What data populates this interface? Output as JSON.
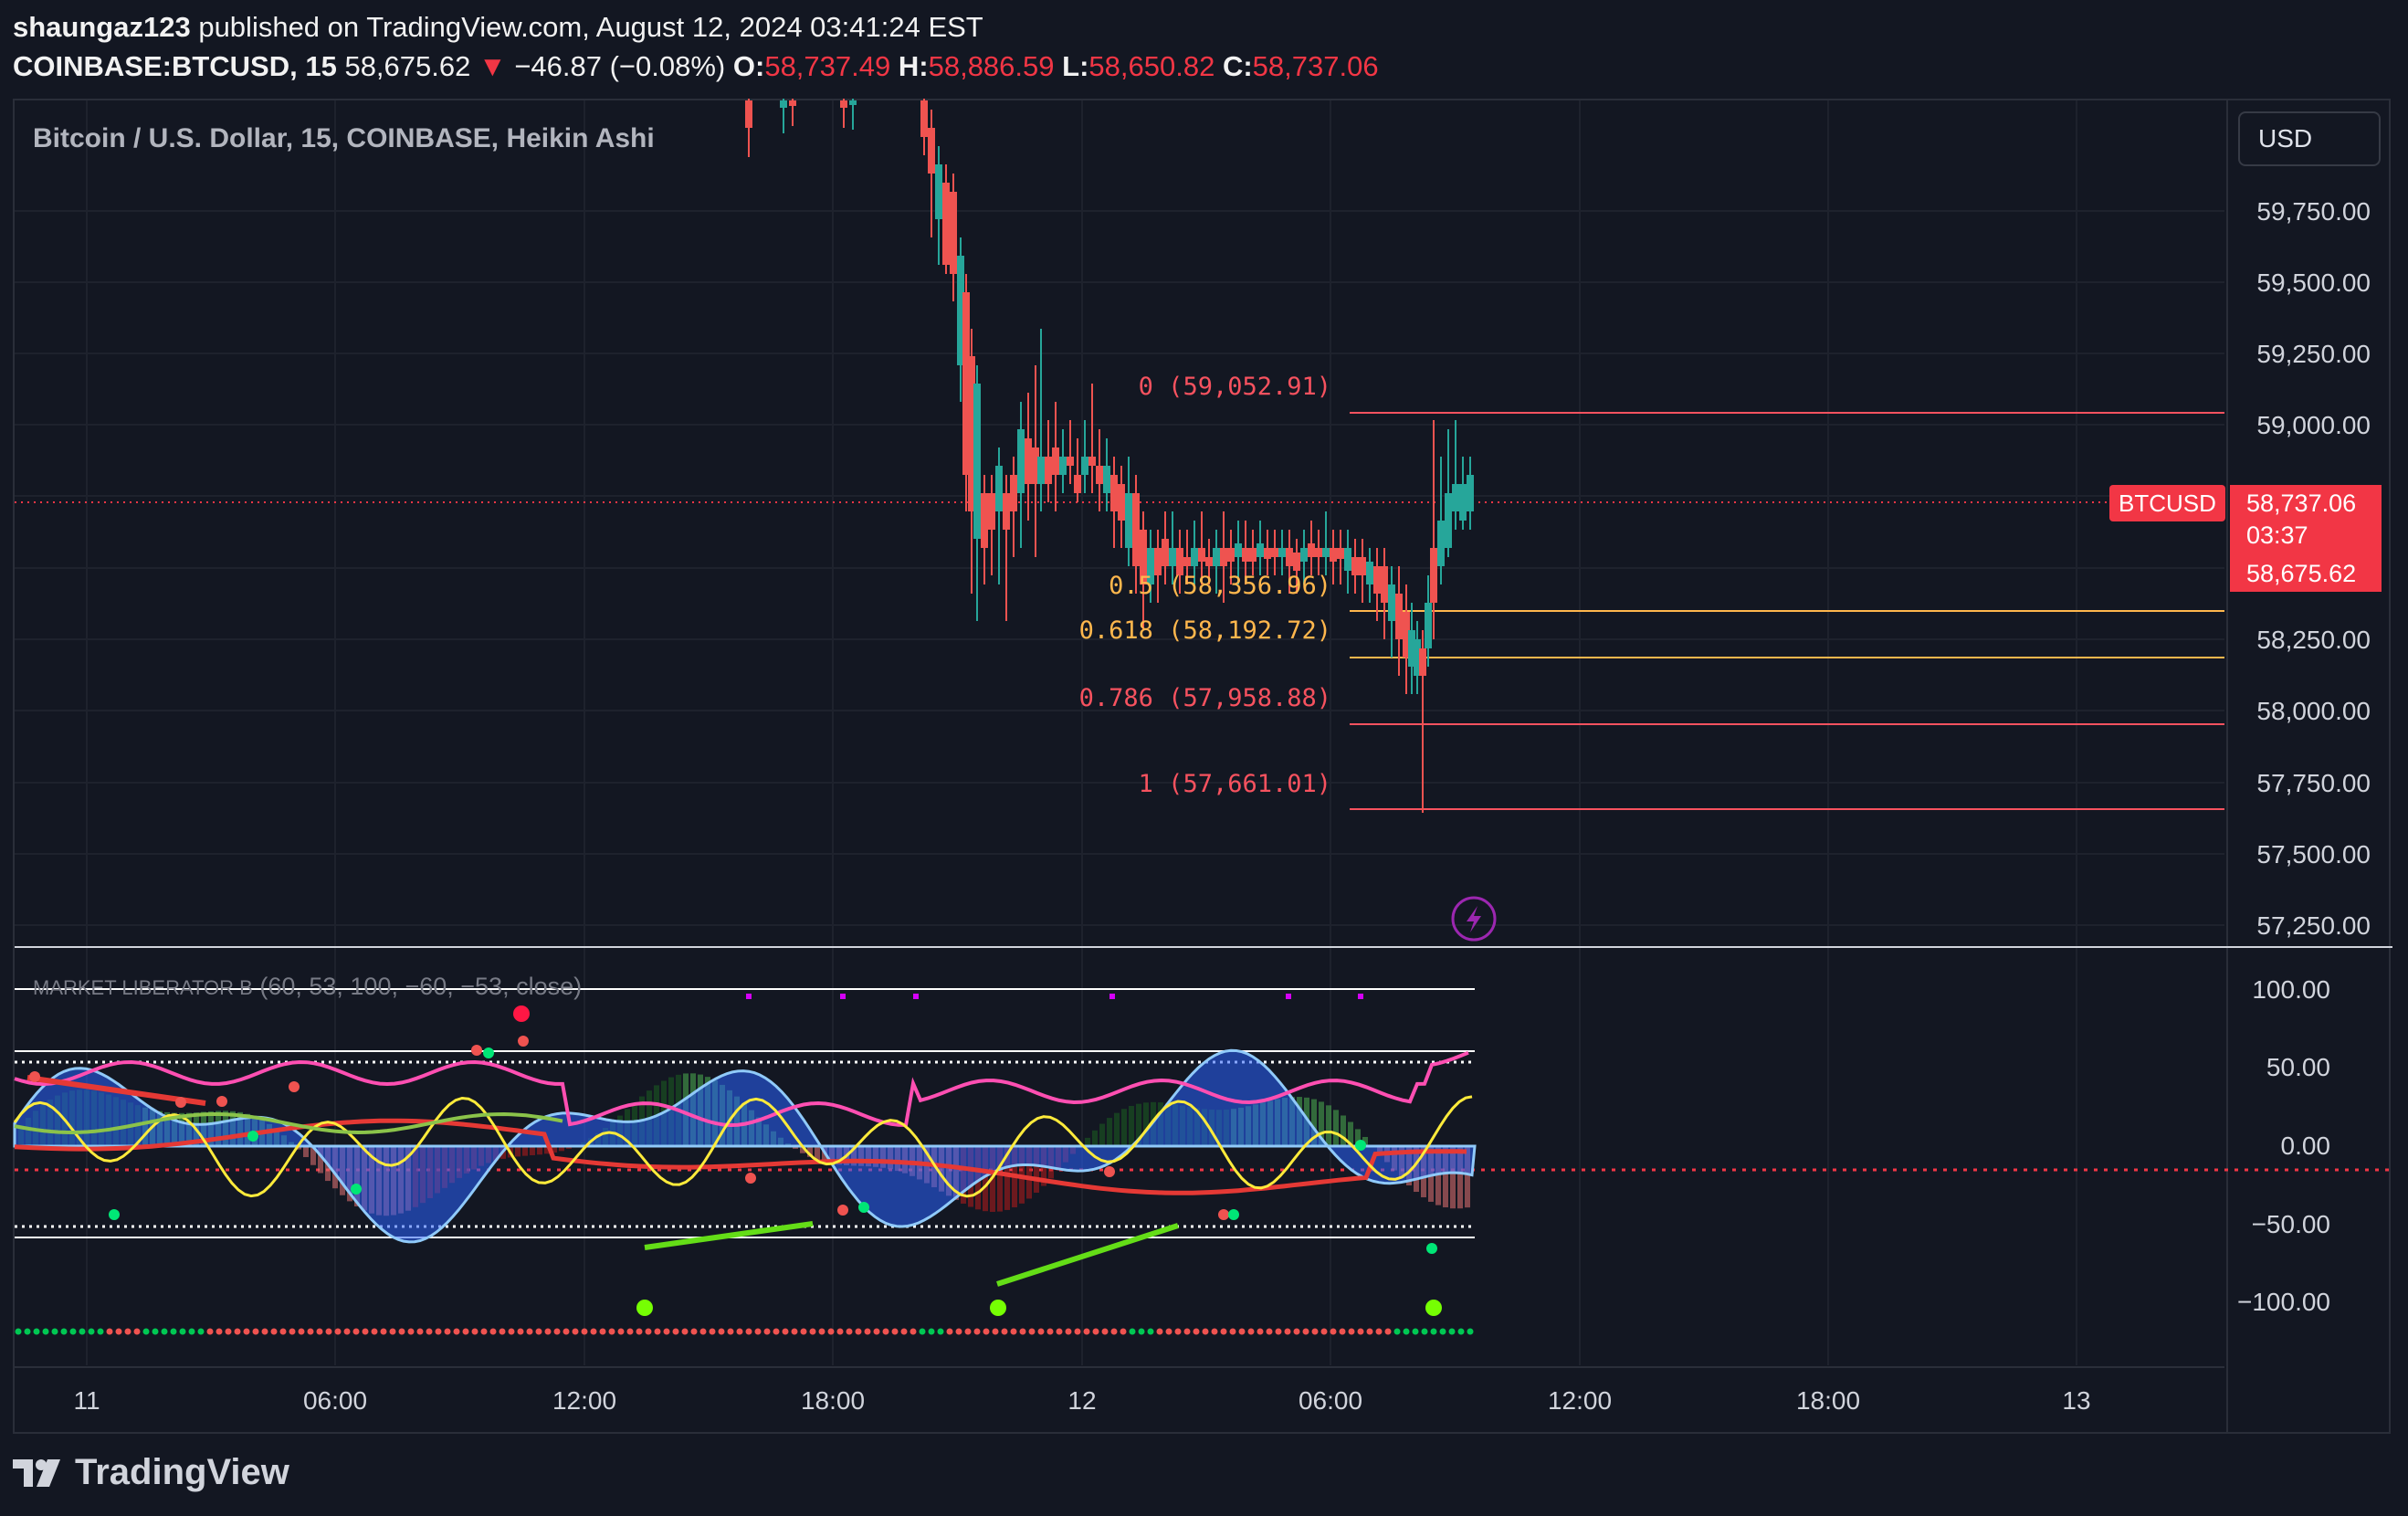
{
  "header": {
    "user": "shaungaz123",
    "published_text": "published on TradingView.com, August 12, 2024 03:41:24 EST",
    "symbol": "COINBASE:BTCUSD, 15",
    "last": "58,675.62",
    "change_arrow": "▼",
    "change": "−46.87 (−0.08%)",
    "o_label": "O:",
    "o_value": "58,737.49",
    "h_label": "H:",
    "h_value": "58,886.59",
    "l_label": "L:",
    "l_value": "58,650.82",
    "c_label": "C:",
    "c_value": "58,737.06"
  },
  "chart": {
    "legend": "Bitcoin / U.S. Dollar, 15, COINBASE, Heikin Ashi",
    "currency_button": "USD",
    "price_ticks": [
      "59,750.00",
      "59,500.00",
      "59,250.00",
      "59,000.00",
      "58,250.00",
      "58,000.00",
      "57,750.00",
      "57,500.00",
      "57,250.00"
    ],
    "symbol_tag": "BTCUSD",
    "current_price": "58,737.06",
    "countdown": "03:37",
    "last_price_tag": "58,675.62",
    "fib_levels": [
      {
        "label": "0 (59,052.91)",
        "color": "#f7525f"
      },
      {
        "label": "0.5 (58,356.96)",
        "color": "#ffb74d"
      },
      {
        "label": "0.618 (58,192.72)",
        "color": "#ffb74d"
      },
      {
        "label": "0.786 (57,958.88)",
        "color": "#f7525f"
      },
      {
        "label": "1 (57,661.01)",
        "color": "#f7525f"
      }
    ],
    "time_ticks": [
      "11",
      "06:00",
      "12:00",
      "18:00",
      "12",
      "06:00",
      "12:00",
      "18:00",
      "13"
    ]
  },
  "indicator": {
    "title": "MARKET LIBERATOR B",
    "params": "(60, 53, 100, −60, −53, close)",
    "ticks": [
      "100.00",
      "50.00",
      "0.00",
      "−50.00",
      "−100.00"
    ]
  },
  "footer": {
    "brand": "TradingView"
  },
  "colors": {
    "up": "#26a69a",
    "down": "#ef5350",
    "background": "#131722",
    "fib_red": "#f7525f",
    "fib_orange": "#ffb74d",
    "magenta": "#e040fb",
    "yellow": "#ffeb3b",
    "green": "#76ff03"
  }
}
